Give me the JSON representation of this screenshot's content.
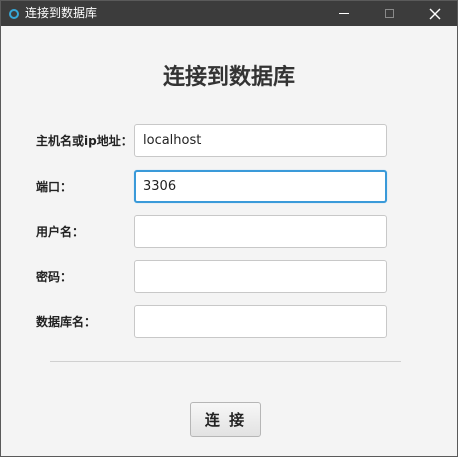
{
  "window": {
    "title": "连接到数据库"
  },
  "form": {
    "heading": "连接到数据库",
    "fields": [
      {
        "label": "主机名或ip地址：",
        "value": "localhost"
      },
      {
        "label": "端口：",
        "value": "3306"
      },
      {
        "label": "用户名：",
        "value": ""
      },
      {
        "label": "密码：",
        "value": ""
      },
      {
        "label": "数据库名：",
        "value": ""
      }
    ],
    "connect_label": "连 接"
  },
  "colors": {
    "titlebar": "#3c3c3c",
    "focus_border": "#3a9ad9",
    "background": "#f4f4f4"
  }
}
